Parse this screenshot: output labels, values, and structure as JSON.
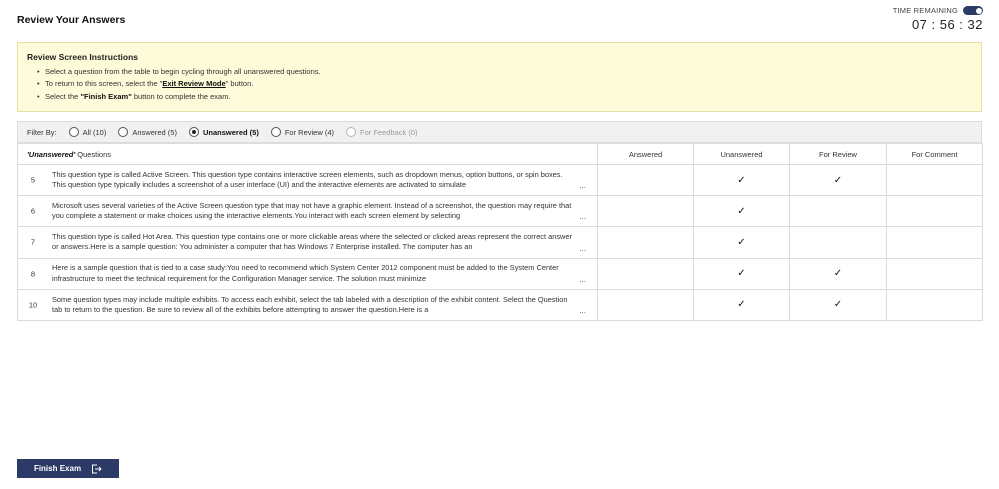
{
  "header": {
    "title": "Review Your Answers",
    "time_label": "TIME REMAINING",
    "time_value": "07 : 56 : 32"
  },
  "instructions": {
    "title": "Review Screen Instructions",
    "line1": "Select a question from the table to begin cycling through all unanswered questions.",
    "line2_pre": "To return to this screen, select the \"",
    "line2_link": "Exit Review Mode",
    "line2_post": "\" button.",
    "line3_pre": "Select the ",
    "line3_bold": "\"Finish Exam\"",
    "line3_post": " button to complete the exam."
  },
  "filter": {
    "label": "Filter By:",
    "options": [
      {
        "label": "All (10)"
      },
      {
        "label": "Answered (5)"
      },
      {
        "label": "Unanswered (5)"
      },
      {
        "label": "For Review (4)"
      },
      {
        "label": "For Feedback (0)"
      }
    ]
  },
  "table": {
    "header_em": "'Unanswered'",
    "header_rest": " Questions",
    "col_answered": "Answered",
    "col_unanswered": "Unanswered",
    "col_review": "For Review",
    "col_comment": "For Comment",
    "check_glyph": "✓",
    "ellipsis": "...",
    "rows": [
      {
        "num": "5",
        "text": "This question type is called Active Screen. This question type contains interactive screen elements, such as dropdown menus, option buttons, or spin boxes. This question type typically includes a screenshot of a user interface (UI) and the interactive elements are activated to simulate",
        "answered": false,
        "unanswered": true,
        "review": true,
        "comment": false
      },
      {
        "num": "6",
        "text": "Microsoft uses several varieties of the Active Screen question type that may not have a graphic element. Instead of a screenshot, the question may require that you complete a statement or make choices using the interactive elements.You interact with each screen element by selecting",
        "answered": false,
        "unanswered": true,
        "review": false,
        "comment": false
      },
      {
        "num": "7",
        "text": "This question type is called Hot Area. This question type contains one or more clickable areas where the selected or clicked areas represent the correct answer or answers.Here is a sample question: You administer a computer that has Windows 7 Enterprise installed. The computer has an",
        "answered": false,
        "unanswered": true,
        "review": false,
        "comment": false
      },
      {
        "num": "8",
        "text": "Here is a sample question that is tied to a case study:You need to recommend which System Center 2012 component must be added to the System Center infrastructure to meet the technical requirement for the Configuration Manager service. The solution must minimize",
        "answered": false,
        "unanswered": true,
        "review": true,
        "comment": false
      },
      {
        "num": "10",
        "text": "Some question types may include multiple exhibits. To access each exhibit, select the tab labeled with a description of the exhibit content. Select the Question tab to return to the question. Be sure to review all of the exhibits before attempting to answer the question.Here is a",
        "answered": false,
        "unanswered": true,
        "review": true,
        "comment": false
      }
    ]
  },
  "footer": {
    "finish_label": "Finish Exam"
  }
}
